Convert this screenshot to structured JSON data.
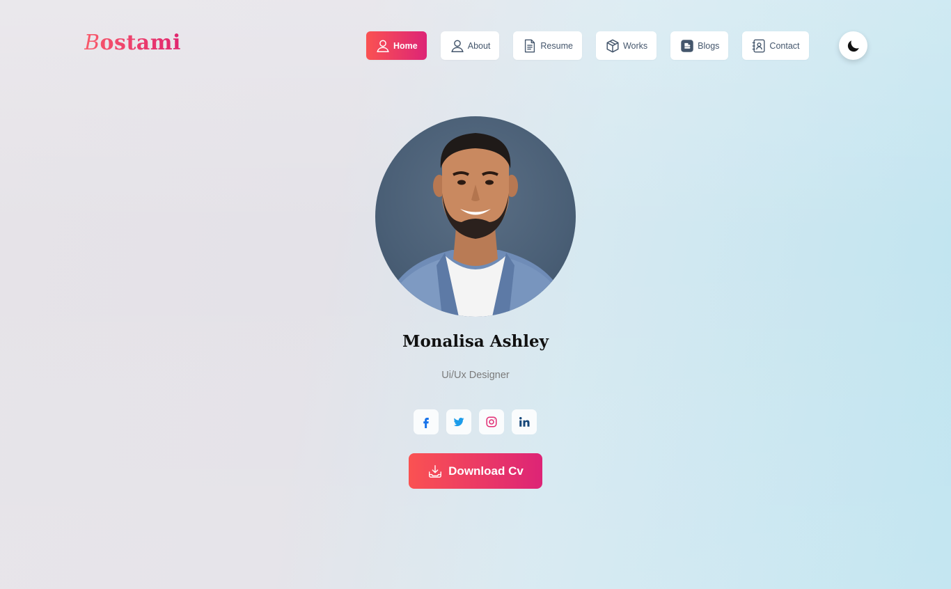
{
  "logo": {
    "first_letter": "B",
    "rest": "ostami"
  },
  "nav": {
    "items": [
      {
        "label": "Home",
        "icon": "user-icon",
        "active": true
      },
      {
        "label": "About",
        "icon": "user-icon",
        "active": false
      },
      {
        "label": "Resume",
        "icon": "document-icon",
        "active": false
      },
      {
        "label": "Works",
        "icon": "box-icon",
        "active": false
      },
      {
        "label": "Blogs",
        "icon": "blog-icon",
        "active": false
      },
      {
        "label": "Contact",
        "icon": "contact-book-icon",
        "active": false
      }
    ]
  },
  "theme_toggle": {
    "icon": "moon-icon"
  },
  "profile": {
    "name": "Monalisa Ashley",
    "role": "Ui/Ux Designer"
  },
  "socials": [
    {
      "icon": "facebook-icon",
      "color": "#1773ea"
    },
    {
      "icon": "twitter-icon",
      "color": "#1c9cea"
    },
    {
      "icon": "instagram-icon",
      "color": "#e12a72"
    },
    {
      "icon": "linkedin-icon",
      "color": "#144679"
    }
  ],
  "download_button": {
    "label": "Download Cv",
    "icon": "download-icon"
  },
  "colors": {
    "accent_start": "#fa5252",
    "accent_end": "#dd2476"
  }
}
